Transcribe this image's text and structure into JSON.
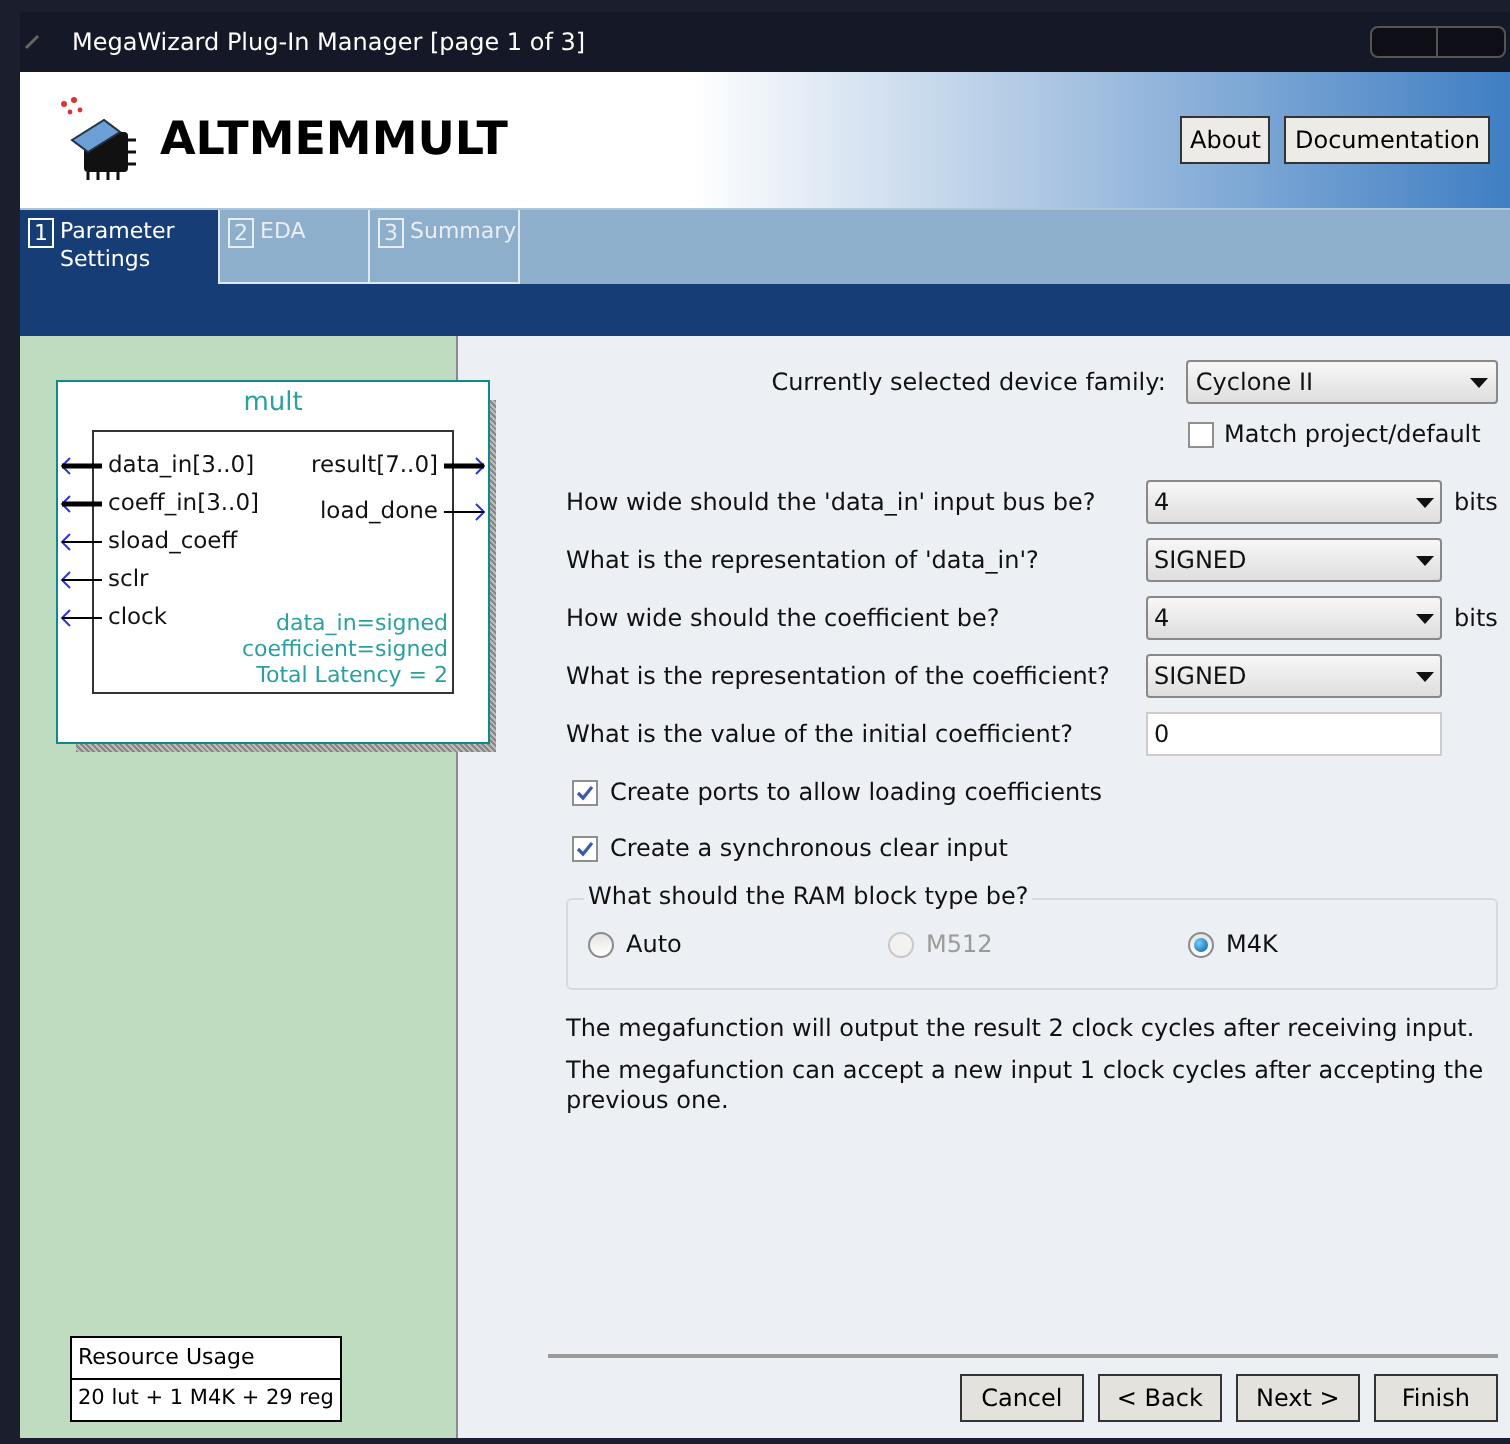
{
  "window": {
    "title": "MegaWizard Plug-In Manager [page 1 of 3]"
  },
  "header": {
    "title": "ALTMEMMULT",
    "buttons": [
      "About",
      "Documentation"
    ]
  },
  "tabs": [
    {
      "number": "1",
      "label": "Parameter Settings",
      "selected": true
    },
    {
      "number": "2",
      "label": "EDA",
      "selected": false
    },
    {
      "number": "3",
      "label": "Summary",
      "selected": false
    }
  ],
  "symbol": {
    "name": "mult",
    "inputs": [
      {
        "label": "data_in[3..0]",
        "bus": true
      },
      {
        "label": "coeff_in[3..0]",
        "bus": true
      },
      {
        "label": "sload_coeff",
        "bus": false
      },
      {
        "label": "sclr",
        "bus": false
      },
      {
        "label": "clock",
        "bus": false
      }
    ],
    "outputs": [
      {
        "label": "result[7..0]",
        "bus": true
      },
      {
        "label": "load_done",
        "bus": false
      }
    ],
    "notes": [
      "data_in=signed",
      "coefficient=signed",
      "Total Latency = 2"
    ]
  },
  "resource_usage": {
    "title": "Resource Usage",
    "value": "20 lut + 1 M4K + 29 reg"
  },
  "device": {
    "label": "Currently selected device family:",
    "value": "Cyclone II",
    "match": {
      "label": "Match project/default",
      "checked": false
    }
  },
  "questions": [
    {
      "kind": "select",
      "label": "How wide should the 'data_in' input bus be?",
      "value": "4",
      "unit": "bits"
    },
    {
      "kind": "select",
      "label": "What is the representation of 'data_in'?",
      "value": "SIGNED"
    },
    {
      "kind": "select",
      "label": "How wide should the coefficient be?",
      "value": "4",
      "unit": "bits"
    },
    {
      "kind": "select",
      "label": "What is the representation of the coefficient?",
      "value": "SIGNED"
    },
    {
      "kind": "input",
      "label": "What is the value of the initial coefficient?",
      "value": "0"
    }
  ],
  "options": [
    {
      "label": "Create ports to allow loading coefficients",
      "checked": true
    },
    {
      "label": "Create a synchronous clear input",
      "checked": true
    }
  ],
  "ram_block": {
    "title": "What should the RAM block type be?",
    "choices": [
      {
        "label": "Auto",
        "selected": false,
        "disabled": false
      },
      {
        "label": "M512",
        "selected": false,
        "disabled": true
      },
      {
        "label": "M4K",
        "selected": true,
        "disabled": false
      }
    ]
  },
  "messages": [
    "The megafunction will output the result 2 clock cycles after receiving input.",
    "The megafunction can accept a new input 1 clock cycles after accepting the previous one."
  ],
  "footer": {
    "buttons": [
      "Cancel",
      "< Back",
      "Next >",
      "Finish"
    ]
  }
}
